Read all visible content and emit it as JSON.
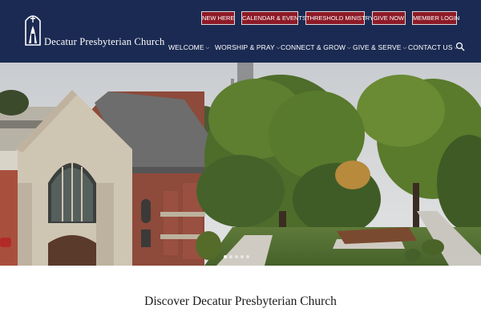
{
  "header": {
    "brand_name": "Decatur Presbyterian Church",
    "utility_links": [
      "NEW HERE",
      "CALENDAR & EVENTS",
      "THRESHOLD MINISTRY",
      "GIVE NOW",
      "MEMBER LOGIN"
    ],
    "nav": [
      "WELCOME",
      "WORSHIP & PRAY",
      "CONNECT & GROW",
      "GIVE & SERVE",
      "CONTACT US"
    ],
    "search_icon": "search-icon"
  },
  "hero": {
    "slides_total": 5,
    "active_slide": 1
  },
  "main": {
    "headline": "Discover Decatur Presbyterian Church"
  },
  "colors": {
    "header_bg": "#1b2a52",
    "button_red": "#8d1a27",
    "text_white": "#ffffff"
  }
}
